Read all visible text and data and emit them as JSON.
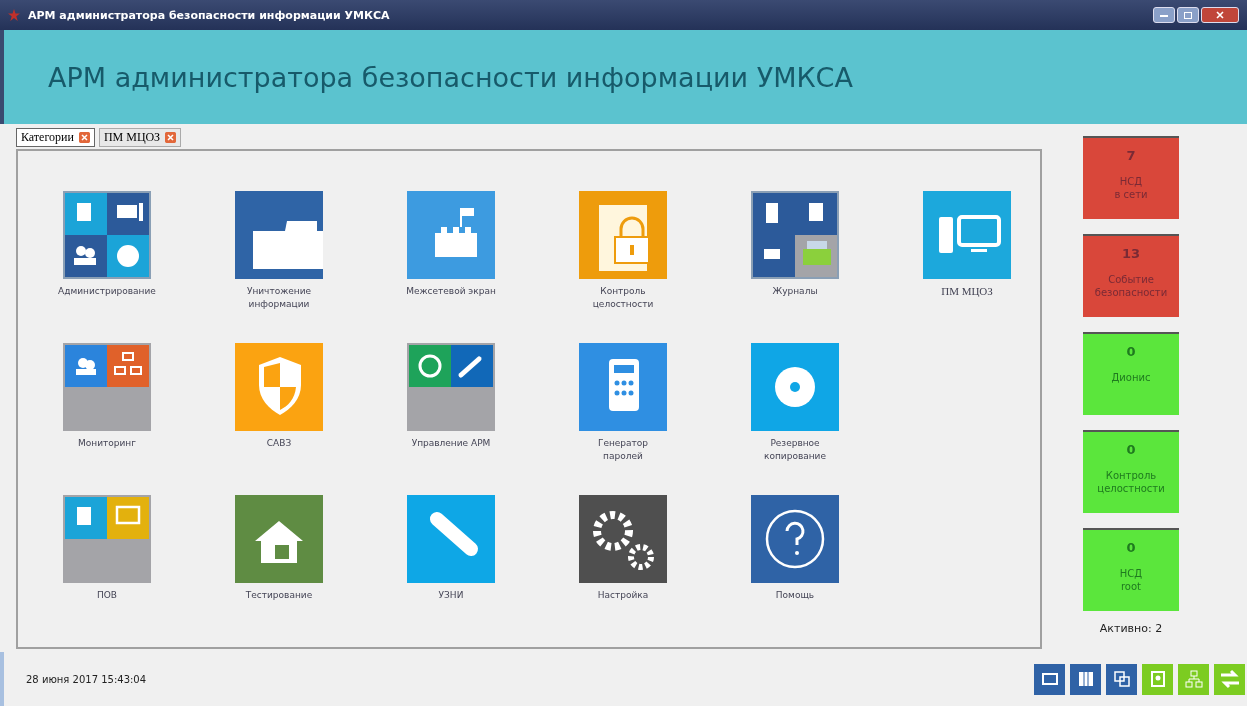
{
  "window": {
    "title": "АРМ администратора безопасности информации УМКСА"
  },
  "header": {
    "title": "АРМ администратора безопасности информации УМКСА"
  },
  "tabs": [
    {
      "label": "Категории",
      "selected": true
    },
    {
      "label": "ПМ МЦОЗ",
      "selected": false
    }
  ],
  "tile_rows": [
    [
      {
        "label": "Администрирование",
        "kind": "quad",
        "color": "#8a9fb5"
      },
      {
        "label": "Уничтожение информации",
        "kind": "single",
        "color": "#2f64a6"
      },
      {
        "label": "Межсетевой экран",
        "kind": "single",
        "color": "#3d9be0"
      },
      {
        "label": "Контроль целостности",
        "kind": "single",
        "color": "#ee9c0c"
      },
      {
        "label": "Журналы",
        "kind": "quad",
        "color": "#8a9fb5"
      },
      {
        "label": "ПМ МЦОЗ",
        "kind": "single",
        "color": "#1ca8dc"
      }
    ],
    [
      {
        "label": "Мониторинг",
        "kind": "quad",
        "color": "#a4a4a8"
      },
      {
        "label": "САВЗ",
        "kind": "single",
        "color": "#fba311"
      },
      {
        "label": "Управление АРМ",
        "kind": "quad",
        "color": "#a4a4a8"
      },
      {
        "label": "Генератор паролей",
        "kind": "single",
        "color": "#2f8fe2"
      },
      {
        "label": "Резервное копирование",
        "kind": "single",
        "color": "#0fa6e6"
      }
    ],
    [
      {
        "label": "ПОВ",
        "kind": "quad",
        "color": "#a4a4a8"
      },
      {
        "label": "Тестирование",
        "kind": "single",
        "color": "#5f8c43"
      },
      {
        "label": "УЗНИ",
        "kind": "single",
        "color": "#0ea7e6"
      },
      {
        "label": "Настройка",
        "kind": "single",
        "color": "#4f4f4f"
      },
      {
        "label": "Помощь",
        "kind": "single",
        "color": "#2f63a6"
      }
    ]
  ],
  "status_cards": [
    {
      "value": "7",
      "label": [
        "НСД",
        "в сети"
      ],
      "kind": "alert"
    },
    {
      "value": "13",
      "label": [
        "Событие",
        "безопасности"
      ],
      "kind": "alert"
    },
    {
      "value": "0",
      "label": [
        "Дионис"
      ],
      "kind": "ok"
    },
    {
      "value": "0",
      "label": [
        "Контроль",
        "целостности"
      ],
      "kind": "ok"
    },
    {
      "value": "0",
      "label": [
        "НСД",
        "root"
      ],
      "kind": "ok"
    }
  ],
  "active": "Активно: 2",
  "status_bar": {
    "datetime": "28 июня 2017 15:43:04"
  },
  "toolbar": [
    {
      "color": "#2f62a6"
    },
    {
      "color": "#2f62a6"
    },
    {
      "color": "#2f62a6"
    },
    {
      "color": "#7ccc21"
    },
    {
      "color": "#7ccc21"
    },
    {
      "color": "#7ccc21"
    }
  ]
}
